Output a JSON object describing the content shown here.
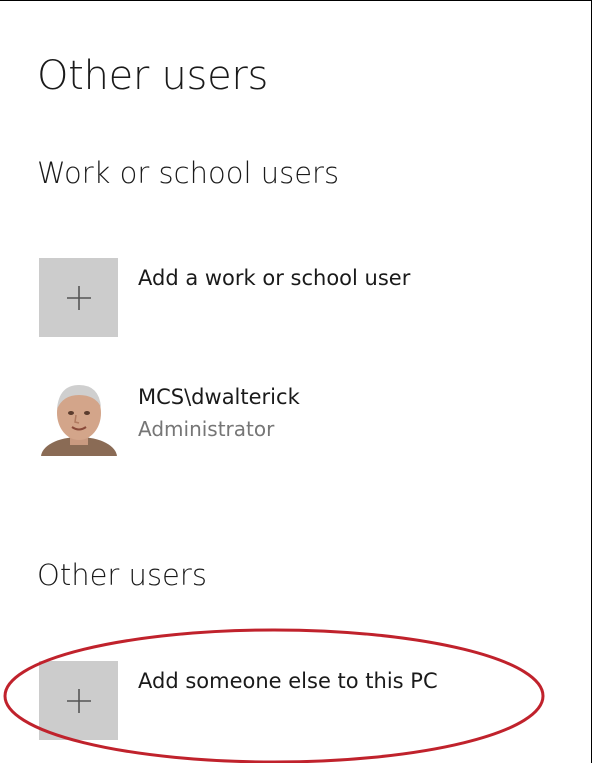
{
  "page": {
    "title": "Other users"
  },
  "work_school": {
    "heading": "Work or school users",
    "add_label": "Add a work or school user",
    "add_icon": "plus-icon",
    "users": [
      {
        "name": "MCS\\dwalterick",
        "role": "Administrator",
        "icon": "user-avatar"
      }
    ]
  },
  "other_users": {
    "heading": "Other users",
    "add_label": "Add someone else to this PC",
    "add_icon": "plus-icon"
  },
  "colors": {
    "tile": "#cccccc",
    "secondary_text": "#767676",
    "annotation": "#c0222c"
  }
}
